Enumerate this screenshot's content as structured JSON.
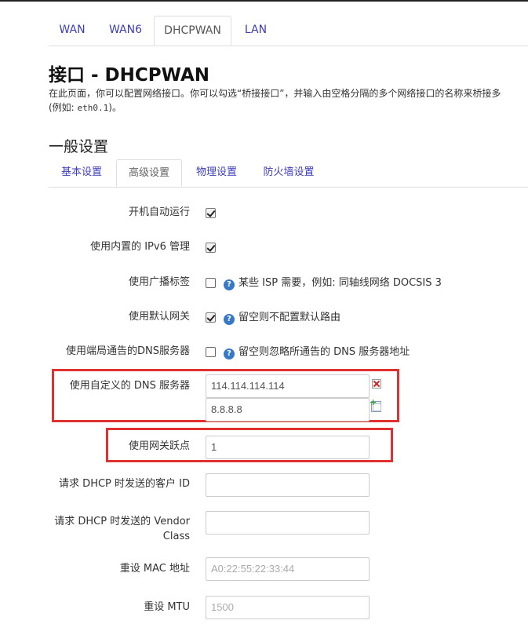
{
  "tabs": [
    "WAN",
    "WAN6",
    "DHCPWAN",
    "LAN"
  ],
  "active_tab": "DHCPWAN",
  "page_title": "接口 - DHCPWAN",
  "description": {
    "line1": "在此页面，你可以配置网络接口。你可以勾选“桥接接口”，并输入由空格分隔的多个网络接口的名称来桥接多",
    "line2_prefix": "(例如: ",
    "line2_code": "eth0.1",
    "line2_suffix": ")。"
  },
  "section_title": "一般设置",
  "sub_tabs": [
    "基本设置",
    "高级设置",
    "物理设置",
    "防火墙设置"
  ],
  "active_sub_tab": "高级设置",
  "fields": {
    "auto_start": {
      "label": "开机自动运行",
      "checked": true
    },
    "builtin_ipv6": {
      "label": "使用内置的 IPv6 管理",
      "checked": true
    },
    "broadcast_flag": {
      "label": "使用广播标签",
      "checked": false,
      "help": "某些 ISP 需要，例如: 同轴线网络 DOCSIS 3"
    },
    "default_gateway": {
      "label": "使用默认网关",
      "checked": true,
      "help": "留空则不配置默认路由"
    },
    "peer_dns": {
      "label": "使用端局通告的DNS服务器",
      "checked": false,
      "help": "留空则忽略所通告的 DNS 服务器地址"
    },
    "custom_dns": {
      "label": "使用自定义的 DNS 服务器",
      "values": [
        "114.114.114.114",
        "8.8.8.8"
      ]
    },
    "gateway_metric": {
      "label": "使用网关跃点",
      "value": "1"
    },
    "client_id": {
      "label": "请求 DHCP 时发送的客户 ID",
      "value": ""
    },
    "vendor_class": {
      "label_line1": "请求 DHCP 时发送的 Vendor",
      "label_line2": "Class",
      "value": ""
    },
    "mac_address": {
      "label": "重设 MAC 地址",
      "placeholder": "A0:22:55:22:33:44"
    },
    "mtu": {
      "label": "重设 MTU",
      "placeholder": "1500"
    }
  },
  "icons": {
    "help": "help-icon",
    "remove": "remove-icon",
    "add": "add-icon"
  },
  "colors": {
    "link": "#3d3dba",
    "highlight": "#e03030",
    "help_icon": "#3778c7"
  }
}
